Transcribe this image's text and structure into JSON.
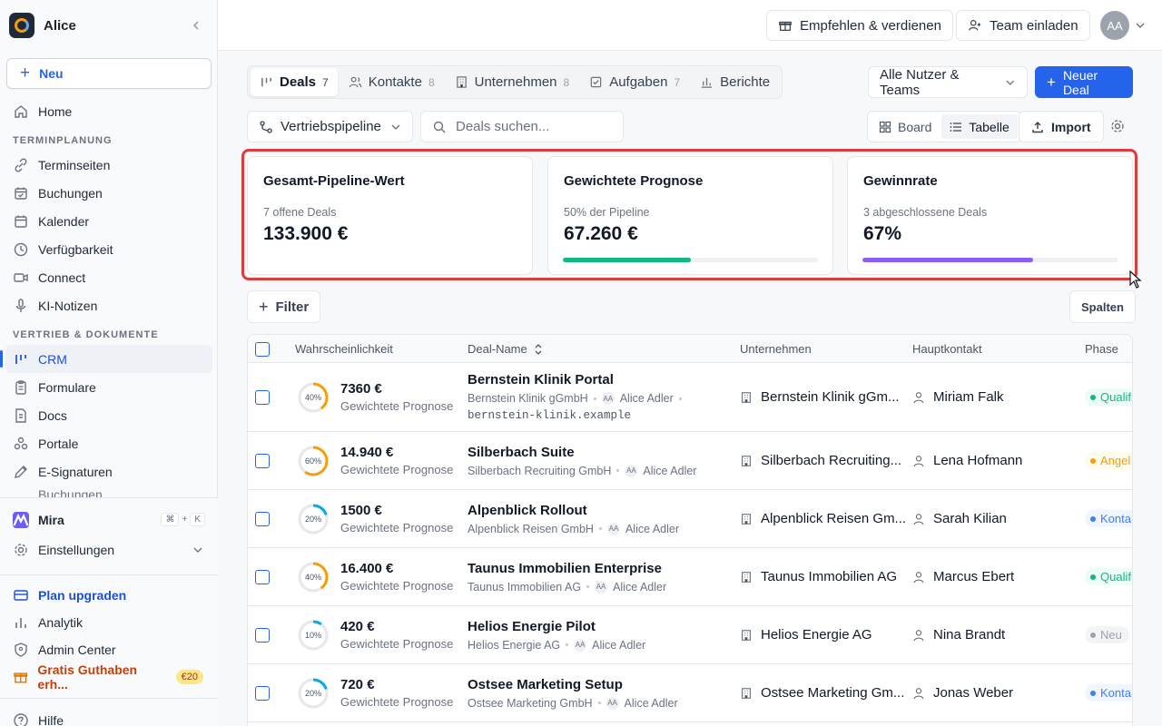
{
  "app": {
    "name": "Alice"
  },
  "sidebar": {
    "new_label": "Neu",
    "home": "Home",
    "section_scheduling": "TERMINPLANUNG",
    "scheduling_items": [
      "Terminseiten",
      "Buchungen",
      "Kalender",
      "Verfügbarkeit",
      "Connect",
      "KI-Notizen"
    ],
    "section_sales": "VERTRIEB & DOKUMENTE",
    "sales_items": [
      "CRM",
      "Formulare",
      "Docs",
      "Portale",
      "E-Signaturen"
    ],
    "sales_partial": "Buchungen",
    "mira": "Mira",
    "mira_shortcut": [
      "⌘",
      "+",
      "K"
    ],
    "settings": "Einstellungen",
    "upgrade": "Plan upgraden",
    "analytics": "Analytik",
    "admin": "Admin Center",
    "credit": "Gratis Guthaben erh...",
    "credit_badge": "€20",
    "help": "Hilfe"
  },
  "topbar": {
    "refer": "Empfehlen & verdienen",
    "invite": "Team einladen",
    "avatar_initials": "AA"
  },
  "tabs": [
    {
      "label": "Deals",
      "count": "7",
      "icon": "deals-icon"
    },
    {
      "label": "Kontakte",
      "count": "8",
      "icon": "contacts-icon"
    },
    {
      "label": "Unternehmen",
      "count": "8",
      "icon": "building-icon"
    },
    {
      "label": "Aufgaben",
      "count": "7",
      "icon": "task-icon"
    },
    {
      "label": "Berichte",
      "count": "",
      "icon": "chart-icon"
    }
  ],
  "toolbar": {
    "users_select": "Alle Nutzer & Teams",
    "new_deal": "Neuer Deal",
    "pipeline": "Vertriebspipeline",
    "search_placeholder": "Deals suchen...",
    "view_board": "Board",
    "view_table": "Tabelle",
    "import": "Import",
    "filter": "Filter",
    "columns": "Spalten"
  },
  "kpis": [
    {
      "title": "Gesamt-Pipeline-Wert",
      "sub": "7 offene Deals",
      "value": "133.900 €",
      "progress": null,
      "color": ""
    },
    {
      "title": "Gewichtete Prognose",
      "sub": "50% der Pipeline",
      "value": "67.260 €",
      "progress": 0.5,
      "color": "#10b981"
    },
    {
      "title": "Gewinnrate",
      "sub": "3 abgeschlossene Deals",
      "value": "67%",
      "progress": 0.67,
      "color": "#8b5cf6"
    }
  ],
  "table": {
    "headers": {
      "probability": "Wahrscheinlichkeit",
      "deal": "Deal-Name",
      "company": "Unternehmen",
      "contact": "Hauptkontakt",
      "phase": "Phase"
    },
    "weighted_label": "Gewichtete Prognose",
    "owner": "Alice Adler",
    "owner_initials": "AA",
    "rows": [
      {
        "pct": "40%",
        "prob": 0.4,
        "ring": "#f59e0b",
        "amount": "7360 €",
        "name": "Bernstein Klinik Portal",
        "company_full": "Bernstein Klinik gGmbH",
        "domain": "bernstein-klinik.example",
        "company": "Bernstein Klinik gGm...",
        "contact": "Miriam Falk",
        "phase": "Qualif",
        "phase_color": "#10b981",
        "phase_bg": "#ecfdf5"
      },
      {
        "pct": "60%",
        "prob": 0.6,
        "ring": "#f59e0b",
        "amount": "14.940 €",
        "name": "Silberbach Suite",
        "company_full": "Silberbach Recruiting GmbH",
        "domain": "",
        "company": "Silberbach Recruiting...",
        "contact": "Lena Hofmann",
        "phase": "Angel",
        "phase_color": "#f59e0b",
        "phase_bg": "#fffbeb"
      },
      {
        "pct": "20%",
        "prob": 0.2,
        "ring": "#0ea5e9",
        "amount": "1500 €",
        "name": "Alpenblick Rollout",
        "company_full": "Alpenblick Reisen GmbH",
        "domain": "",
        "company": "Alpenblick Reisen Gm...",
        "contact": "Sarah Kilian",
        "phase": "Konta",
        "phase_color": "#3b82f6",
        "phase_bg": "#eff6ff"
      },
      {
        "pct": "40%",
        "prob": 0.4,
        "ring": "#f59e0b",
        "amount": "16.400 €",
        "name": "Taunus Immobilien Enterprise",
        "company_full": "Taunus Immobilien AG",
        "domain": "",
        "company": "Taunus Immobilien AG",
        "contact": "Marcus Ebert",
        "phase": "Qualif",
        "phase_color": "#10b981",
        "phase_bg": "#ecfdf5"
      },
      {
        "pct": "10%",
        "prob": 0.1,
        "ring": "#0ea5e9",
        "amount": "420 €",
        "name": "Helios Energie Pilot",
        "company_full": "Helios Energie AG",
        "domain": "",
        "company": "Helios Energie AG",
        "contact": "Nina Brandt",
        "phase": "Neu",
        "phase_color": "#9ca3af",
        "phase_bg": "#f3f4f6"
      },
      {
        "pct": "20%",
        "prob": 0.2,
        "ring": "#0ea5e9",
        "amount": "720 €",
        "name": "Ostsee Marketing Setup",
        "company_full": "Ostsee Marketing GmbH",
        "domain": "",
        "company": "Ostsee Marketing Gm...",
        "contact": "Jonas Weber",
        "phase": "Konta",
        "phase_color": "#3b82f6",
        "phase_bg": "#eff6ff"
      }
    ]
  },
  "colors": {
    "primary": "#2563eb",
    "highlight": "#dc3c3c"
  }
}
